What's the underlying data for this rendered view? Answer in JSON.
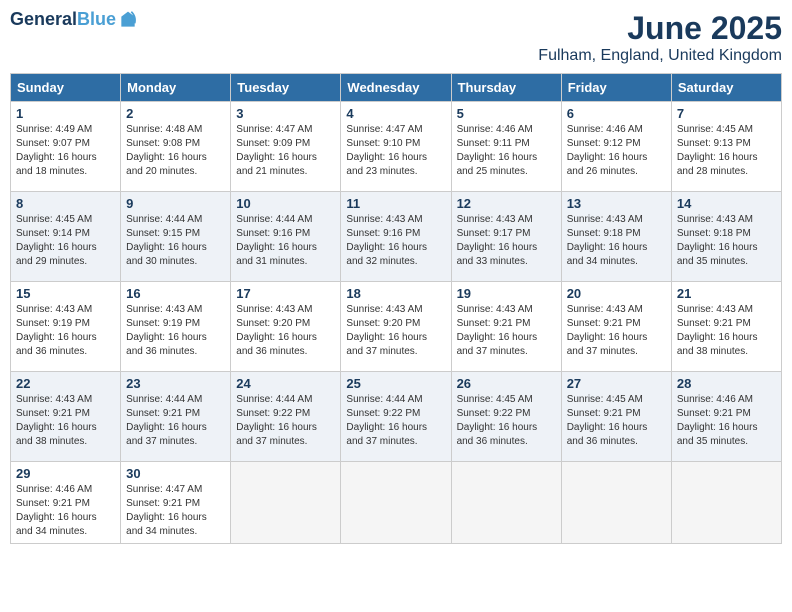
{
  "header": {
    "logo_line1": "General",
    "logo_line2": "Blue",
    "month": "June 2025",
    "location": "Fulham, England, United Kingdom"
  },
  "days_of_week": [
    "Sunday",
    "Monday",
    "Tuesday",
    "Wednesday",
    "Thursday",
    "Friday",
    "Saturday"
  ],
  "weeks": [
    [
      {
        "day": "1",
        "rise": "Sunrise: 4:49 AM",
        "set": "Sunset: 9:07 PM",
        "daylight": "Daylight: 16 hours and 18 minutes."
      },
      {
        "day": "2",
        "rise": "Sunrise: 4:48 AM",
        "set": "Sunset: 9:08 PM",
        "daylight": "Daylight: 16 hours and 20 minutes."
      },
      {
        "day": "3",
        "rise": "Sunrise: 4:47 AM",
        "set": "Sunset: 9:09 PM",
        "daylight": "Daylight: 16 hours and 21 minutes."
      },
      {
        "day": "4",
        "rise": "Sunrise: 4:47 AM",
        "set": "Sunset: 9:10 PM",
        "daylight": "Daylight: 16 hours and 23 minutes."
      },
      {
        "day": "5",
        "rise": "Sunrise: 4:46 AM",
        "set": "Sunset: 9:11 PM",
        "daylight": "Daylight: 16 hours and 25 minutes."
      },
      {
        "day": "6",
        "rise": "Sunrise: 4:46 AM",
        "set": "Sunset: 9:12 PM",
        "daylight": "Daylight: 16 hours and 26 minutes."
      },
      {
        "day": "7",
        "rise": "Sunrise: 4:45 AM",
        "set": "Sunset: 9:13 PM",
        "daylight": "Daylight: 16 hours and 28 minutes."
      }
    ],
    [
      {
        "day": "8",
        "rise": "Sunrise: 4:45 AM",
        "set": "Sunset: 9:14 PM",
        "daylight": "Daylight: 16 hours and 29 minutes."
      },
      {
        "day": "9",
        "rise": "Sunrise: 4:44 AM",
        "set": "Sunset: 9:15 PM",
        "daylight": "Daylight: 16 hours and 30 minutes."
      },
      {
        "day": "10",
        "rise": "Sunrise: 4:44 AM",
        "set": "Sunset: 9:16 PM",
        "daylight": "Daylight: 16 hours and 31 minutes."
      },
      {
        "day": "11",
        "rise": "Sunrise: 4:43 AM",
        "set": "Sunset: 9:16 PM",
        "daylight": "Daylight: 16 hours and 32 minutes."
      },
      {
        "day": "12",
        "rise": "Sunrise: 4:43 AM",
        "set": "Sunset: 9:17 PM",
        "daylight": "Daylight: 16 hours and 33 minutes."
      },
      {
        "day": "13",
        "rise": "Sunrise: 4:43 AM",
        "set": "Sunset: 9:18 PM",
        "daylight": "Daylight: 16 hours and 34 minutes."
      },
      {
        "day": "14",
        "rise": "Sunrise: 4:43 AM",
        "set": "Sunset: 9:18 PM",
        "daylight": "Daylight: 16 hours and 35 minutes."
      }
    ],
    [
      {
        "day": "15",
        "rise": "Sunrise: 4:43 AM",
        "set": "Sunset: 9:19 PM",
        "daylight": "Daylight: 16 hours and 36 minutes."
      },
      {
        "day": "16",
        "rise": "Sunrise: 4:43 AM",
        "set": "Sunset: 9:19 PM",
        "daylight": "Daylight: 16 hours and 36 minutes."
      },
      {
        "day": "17",
        "rise": "Sunrise: 4:43 AM",
        "set": "Sunset: 9:20 PM",
        "daylight": "Daylight: 16 hours and 36 minutes."
      },
      {
        "day": "18",
        "rise": "Sunrise: 4:43 AM",
        "set": "Sunset: 9:20 PM",
        "daylight": "Daylight: 16 hours and 37 minutes."
      },
      {
        "day": "19",
        "rise": "Sunrise: 4:43 AM",
        "set": "Sunset: 9:21 PM",
        "daylight": "Daylight: 16 hours and 37 minutes."
      },
      {
        "day": "20",
        "rise": "Sunrise: 4:43 AM",
        "set": "Sunset: 9:21 PM",
        "daylight": "Daylight: 16 hours and 37 minutes."
      },
      {
        "day": "21",
        "rise": "Sunrise: 4:43 AM",
        "set": "Sunset: 9:21 PM",
        "daylight": "Daylight: 16 hours and 38 minutes."
      }
    ],
    [
      {
        "day": "22",
        "rise": "Sunrise: 4:43 AM",
        "set": "Sunset: 9:21 PM",
        "daylight": "Daylight: 16 hours and 38 minutes."
      },
      {
        "day": "23",
        "rise": "Sunrise: 4:44 AM",
        "set": "Sunset: 9:21 PM",
        "daylight": "Daylight: 16 hours and 37 minutes."
      },
      {
        "day": "24",
        "rise": "Sunrise: 4:44 AM",
        "set": "Sunset: 9:22 PM",
        "daylight": "Daylight: 16 hours and 37 minutes."
      },
      {
        "day": "25",
        "rise": "Sunrise: 4:44 AM",
        "set": "Sunset: 9:22 PM",
        "daylight": "Daylight: 16 hours and 37 minutes."
      },
      {
        "day": "26",
        "rise": "Sunrise: 4:45 AM",
        "set": "Sunset: 9:22 PM",
        "daylight": "Daylight: 16 hours and 36 minutes."
      },
      {
        "day": "27",
        "rise": "Sunrise: 4:45 AM",
        "set": "Sunset: 9:21 PM",
        "daylight": "Daylight: 16 hours and 36 minutes."
      },
      {
        "day": "28",
        "rise": "Sunrise: 4:46 AM",
        "set": "Sunset: 9:21 PM",
        "daylight": "Daylight: 16 hours and 35 minutes."
      }
    ],
    [
      {
        "day": "29",
        "rise": "Sunrise: 4:46 AM",
        "set": "Sunset: 9:21 PM",
        "daylight": "Daylight: 16 hours and 34 minutes."
      },
      {
        "day": "30",
        "rise": "Sunrise: 4:47 AM",
        "set": "Sunset: 9:21 PM",
        "daylight": "Daylight: 16 hours and 34 minutes."
      },
      null,
      null,
      null,
      null,
      null
    ]
  ]
}
